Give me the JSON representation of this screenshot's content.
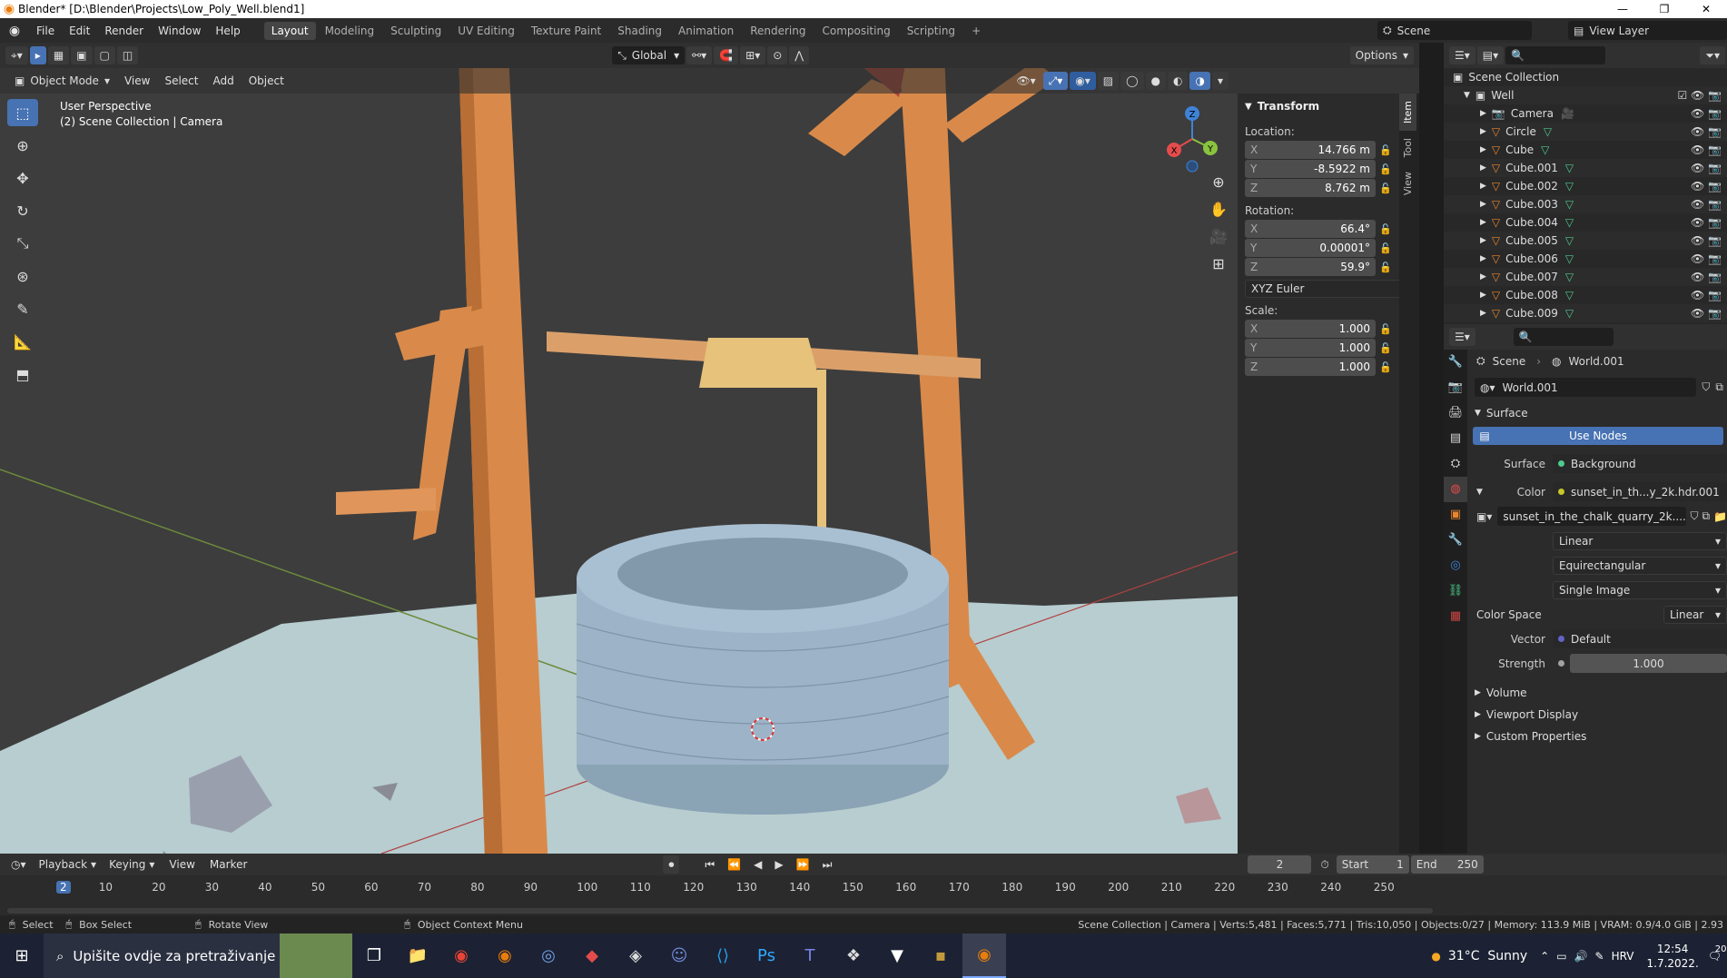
{
  "window": {
    "title": "Blender* [D:\\Blender\\Projects\\Low_Poly_Well.blend1]",
    "controls": [
      "—",
      "❐",
      "✕"
    ]
  },
  "topbar": {
    "menus": [
      "File",
      "Edit",
      "Render",
      "Window",
      "Help"
    ],
    "workspaces": [
      "Layout",
      "Modeling",
      "Sculpting",
      "UV Editing",
      "Texture Paint",
      "Shading",
      "Animation",
      "Rendering",
      "Compositing",
      "Scripting"
    ],
    "active_workspace": "Layout",
    "add_tab": "+",
    "scene": "Scene",
    "view_layer": "View Layer"
  },
  "viewport": {
    "transform_orientation": "Global",
    "options_label": "Options",
    "mode": "Object Mode",
    "menus": [
      "View",
      "Select",
      "Add",
      "Object"
    ],
    "perspective": "User Perspective",
    "collection_info": "(2) Scene Collection | Camera",
    "gizmo_axes": {
      "x": "X",
      "y": "Y",
      "z": "Z"
    }
  },
  "npanel": {
    "tabs": [
      "Item",
      "Tool",
      "View"
    ],
    "active_tab": "Item",
    "section": "Transform",
    "location_label": "Location:",
    "location": [
      {
        "axis": "X",
        "value": "14.766 m"
      },
      {
        "axis": "Y",
        "value": "-8.5922 m"
      },
      {
        "axis": "Z",
        "value": "8.762 m"
      }
    ],
    "rotation_label": "Rotation:",
    "rotation": [
      {
        "axis": "X",
        "value": "66.4°"
      },
      {
        "axis": "Y",
        "value": "0.00001°"
      },
      {
        "axis": "Z",
        "value": "59.9°"
      }
    ],
    "rotation_mode": "XYZ Euler",
    "scale_label": "Scale:",
    "scale": [
      {
        "axis": "X",
        "value": "1.000"
      },
      {
        "axis": "Y",
        "value": "1.000"
      },
      {
        "axis": "Z",
        "value": "1.000"
      }
    ]
  },
  "outliner": {
    "root": "Scene Collection",
    "collection": "Well",
    "items": [
      "Camera",
      "Circle",
      "Cube",
      "Cube.001",
      "Cube.002",
      "Cube.003",
      "Cube.004",
      "Cube.005",
      "Cube.006",
      "Cube.007",
      "Cube.008",
      "Cube.009"
    ]
  },
  "properties": {
    "breadcrumb_scene": "Scene",
    "breadcrumb_world": "World.001",
    "world_name": "World.001",
    "surface_section": "Surface",
    "use_nodes": "Use Nodes",
    "surface_label": "Surface",
    "surface_value": "Background",
    "color_label": "Color",
    "color_value": "sunset_in_th...y_2k.hdr.001",
    "image_name": "sunset_in_the_chalk_quarry_2k....",
    "interpolation": "Linear",
    "projection": "Equirectangular",
    "source": "Single Image",
    "color_space_label": "Color Space",
    "color_space_value": "Linear",
    "vector_label": "Vector",
    "vector_value": "Default",
    "strength_label": "Strength",
    "strength_value": "1.000",
    "sections": [
      "Volume",
      "Viewport Display",
      "Custom Properties"
    ]
  },
  "timeline": {
    "menus": [
      "Playback",
      "Keying",
      "View",
      "Marker"
    ],
    "current_frame": "2",
    "start_label": "Start",
    "start": "1",
    "end_label": "End",
    "end": "250",
    "ruler": [
      "2",
      "10",
      "20",
      "30",
      "40",
      "50",
      "60",
      "70",
      "80",
      "90",
      "100",
      "110",
      "120",
      "130",
      "140",
      "150",
      "160",
      "170",
      "180",
      "190",
      "200",
      "210",
      "220",
      "230",
      "240",
      "250"
    ]
  },
  "statusbar": {
    "select": "Select",
    "box_select": "Box Select",
    "rotate_view": "Rotate View",
    "context_menu": "Object Context Menu",
    "stats": "Scene Collection | Camera | Verts:5,481 | Faces:5,771 | Tris:10,050 | Objects:0/27 | Memory: 113.9 MiB | VRAM: 0.9/4.0 GiB | 2.93"
  },
  "taskbar": {
    "search_placeholder": "Upišite ovdje za pretraživanje",
    "weather": "31°C  Sunny",
    "language": "HRV",
    "time": "12:54",
    "date": "1.7.2022.",
    "notifications": "20"
  },
  "colors": {
    "accent": "#4772b3",
    "object_orange": "#e8852f",
    "mesh_green": "#4ec98c",
    "x_axis": "#e44c4c",
    "y_axis": "#8ac33f",
    "z_axis": "#3f83d8"
  }
}
